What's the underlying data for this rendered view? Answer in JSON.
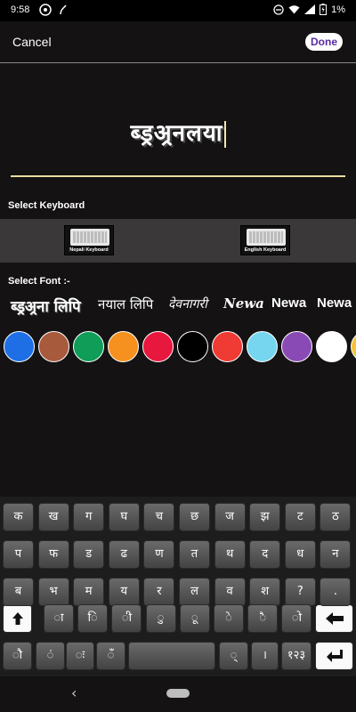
{
  "status": {
    "time": "9:58",
    "battery": "1%"
  },
  "header": {
    "cancel_label": "Cancel",
    "done_label": "Done"
  },
  "editor": {
    "text": "ब्ड्रअ्रनलया"
  },
  "labels": {
    "select_keyboard": "Select Keyboard",
    "select_font": "Select Font :-"
  },
  "keyboards": [
    "Nepali Keyboard",
    "English Keyboard"
  ],
  "fonts": [
    "ब्ड्रअ्रना लिपि",
    "नयाल लिपि",
    "देवनागरी",
    "Newa",
    "Newa",
    "Newa"
  ],
  "colors": [
    "#1e6fe6",
    "#a85a3c",
    "#0f9d58",
    "#f6901e",
    "#e8173e",
    "#000000",
    "#f03b34",
    "#76d6ef",
    "#8a4ab6",
    "#ffffff",
    "#f5c33b"
  ],
  "keys": {
    "row1": [
      "क",
      "ख",
      "ग",
      "घ",
      "च",
      "छ",
      "ज",
      "झ",
      "ट",
      "ठ"
    ],
    "row2": [
      "प",
      "फ",
      "ड",
      "ढ",
      "ण",
      "त",
      "थ",
      "द",
      "ध",
      "न"
    ],
    "row3": [
      "ब",
      "भ",
      "म",
      "य",
      "र",
      "ल",
      "व",
      "श",
      "?",
      "."
    ],
    "row4": [
      "ा",
      "ि",
      "ी",
      "ु",
      "ू",
      "े",
      "ै",
      "ो"
    ],
    "row5": [
      "ौ",
      "ं",
      "ः",
      "ँ",
      "्",
      "।",
      "१२३"
    ]
  }
}
